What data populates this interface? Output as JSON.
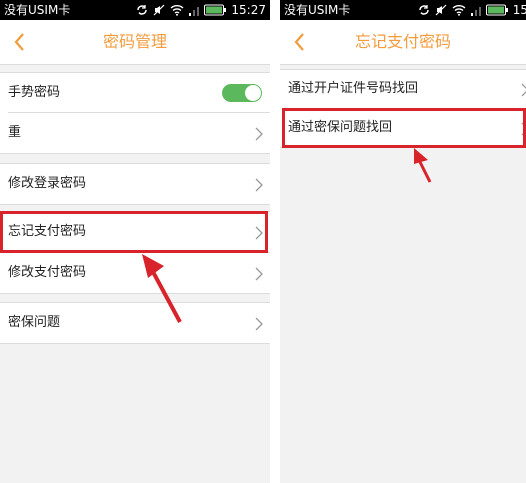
{
  "status_bar": {
    "carrier": "没有USIM卡",
    "time_left": "15:27",
    "time_right": "15"
  },
  "left_screen": {
    "title": "密码管理",
    "rows": [
      {
        "label": "手势密码",
        "toggle": true
      },
      {
        "label": "重"
      },
      {
        "label": "修改登录密码"
      },
      {
        "label": "忘记支付密码"
      },
      {
        "label": "修改支付密码"
      },
      {
        "label": "密保问题"
      }
    ]
  },
  "right_screen": {
    "title": "忘记支付密码",
    "rows": [
      {
        "label": "通过开户证件号码找回"
      },
      {
        "label": "通过密保问题找回"
      }
    ]
  },
  "colors": {
    "accent": "#f39c3c",
    "toggle_on": "#5cb85c",
    "highlight": "#d9232b"
  }
}
